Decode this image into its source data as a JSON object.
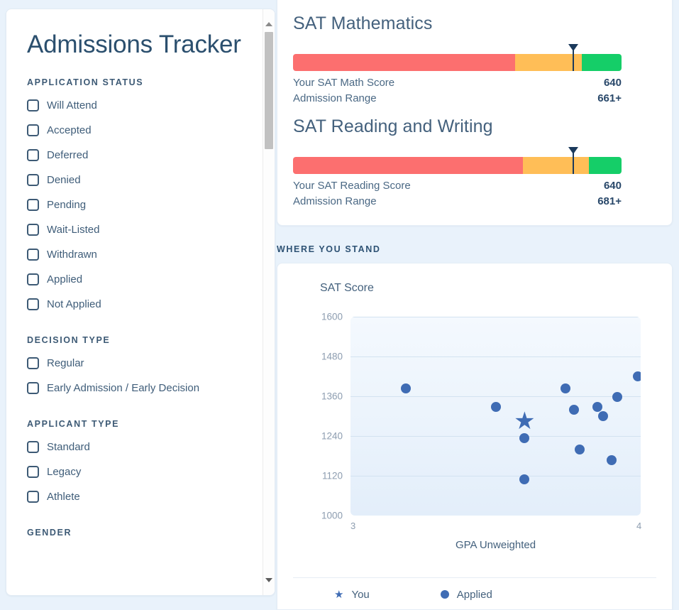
{
  "app": {
    "title": "Admissions Tracker"
  },
  "sidebar": {
    "sections": [
      {
        "label": "APPLICATION STATUS",
        "items": [
          {
            "label": "Will Attend",
            "checked": false
          },
          {
            "label": "Accepted",
            "checked": false
          },
          {
            "label": "Deferred",
            "checked": false
          },
          {
            "label": "Denied",
            "checked": false
          },
          {
            "label": "Pending",
            "checked": false
          },
          {
            "label": "Wait-Listed",
            "checked": false
          },
          {
            "label": "Withdrawn",
            "checked": false
          },
          {
            "label": "Applied",
            "checked": false
          },
          {
            "label": "Not Applied",
            "checked": false
          }
        ]
      },
      {
        "label": "DECISION TYPE",
        "items": [
          {
            "label": "Regular",
            "checked": false
          },
          {
            "label": "Early Admission / Early Decision",
            "checked": false
          }
        ]
      },
      {
        "label": "APPLICANT TYPE",
        "items": [
          {
            "label": "Standard",
            "checked": false
          },
          {
            "label": "Legacy",
            "checked": false
          },
          {
            "label": "Athlete",
            "checked": false
          }
        ]
      },
      {
        "label": "GENDER",
        "items": []
      }
    ]
  },
  "scores": [
    {
      "title": "SAT Mathematics",
      "score_label": "Your SAT Math Score",
      "score_value": "640",
      "range_label": "Admission Range",
      "range_value": "661+",
      "segments": [
        {
          "color": "#FC6F6F",
          "pct": 67.6
        },
        {
          "color": "#FFBE57",
          "pct": 20.4
        },
        {
          "color": "#15CE68",
          "pct": 12.0
        }
      ],
      "marker_pct": 85.0
    },
    {
      "title": "SAT Reading and Writing",
      "score_label": "Your SAT Reading Score",
      "score_value": "640",
      "range_label": "Admission Range",
      "range_value": "681+",
      "segments": [
        {
          "color": "#FC6F6F",
          "pct": 70.0
        },
        {
          "color": "#FFBE57",
          "pct": 20.0
        },
        {
          "color": "#15CE68",
          "pct": 10.0
        }
      ],
      "marker_pct": 85.0
    }
  ],
  "where_you_stand": {
    "label": "WHERE YOU STAND"
  },
  "chart_data": {
    "type": "scatter",
    "title": "SAT Score",
    "xlabel": "GPA Unweighted",
    "ylabel": "SAT Score",
    "xlim": [
      3,
      4
    ],
    "ylim": [
      1000,
      1600
    ],
    "xticks": [
      "3",
      "4"
    ],
    "yticks": [
      "1000",
      "1120",
      "1240",
      "1360",
      "1480",
      "1600"
    ],
    "grid": true,
    "legend_position": "bottom",
    "legend": [
      {
        "name": "You",
        "marker": "star",
        "color": "#3f6cb4"
      },
      {
        "name": "Applied",
        "marker": "circle",
        "color": "#3f6cb4"
      }
    ],
    "series": [
      {
        "name": "Applied",
        "marker": "circle",
        "color": "#3f6cb4",
        "points": [
          {
            "x": 3.19,
            "y": 1383
          },
          {
            "x": 3.5,
            "y": 1327
          },
          {
            "x": 3.6,
            "y": 1234
          },
          {
            "x": 3.6,
            "y": 1110
          },
          {
            "x": 3.74,
            "y": 1383
          },
          {
            "x": 3.77,
            "y": 1320
          },
          {
            "x": 3.79,
            "y": 1200
          },
          {
            "x": 3.85,
            "y": 1327
          },
          {
            "x": 3.87,
            "y": 1301
          },
          {
            "x": 3.9,
            "y": 1167
          },
          {
            "x": 3.92,
            "y": 1357
          },
          {
            "x": 3.99,
            "y": 1421
          }
        ]
      },
      {
        "name": "You",
        "marker": "star",
        "color": "#3f6cb4",
        "points": [
          {
            "x": 3.6,
            "y": 1285
          }
        ]
      }
    ]
  },
  "scrollbar": {
    "up": "scroll-up",
    "down": "scroll-down"
  }
}
